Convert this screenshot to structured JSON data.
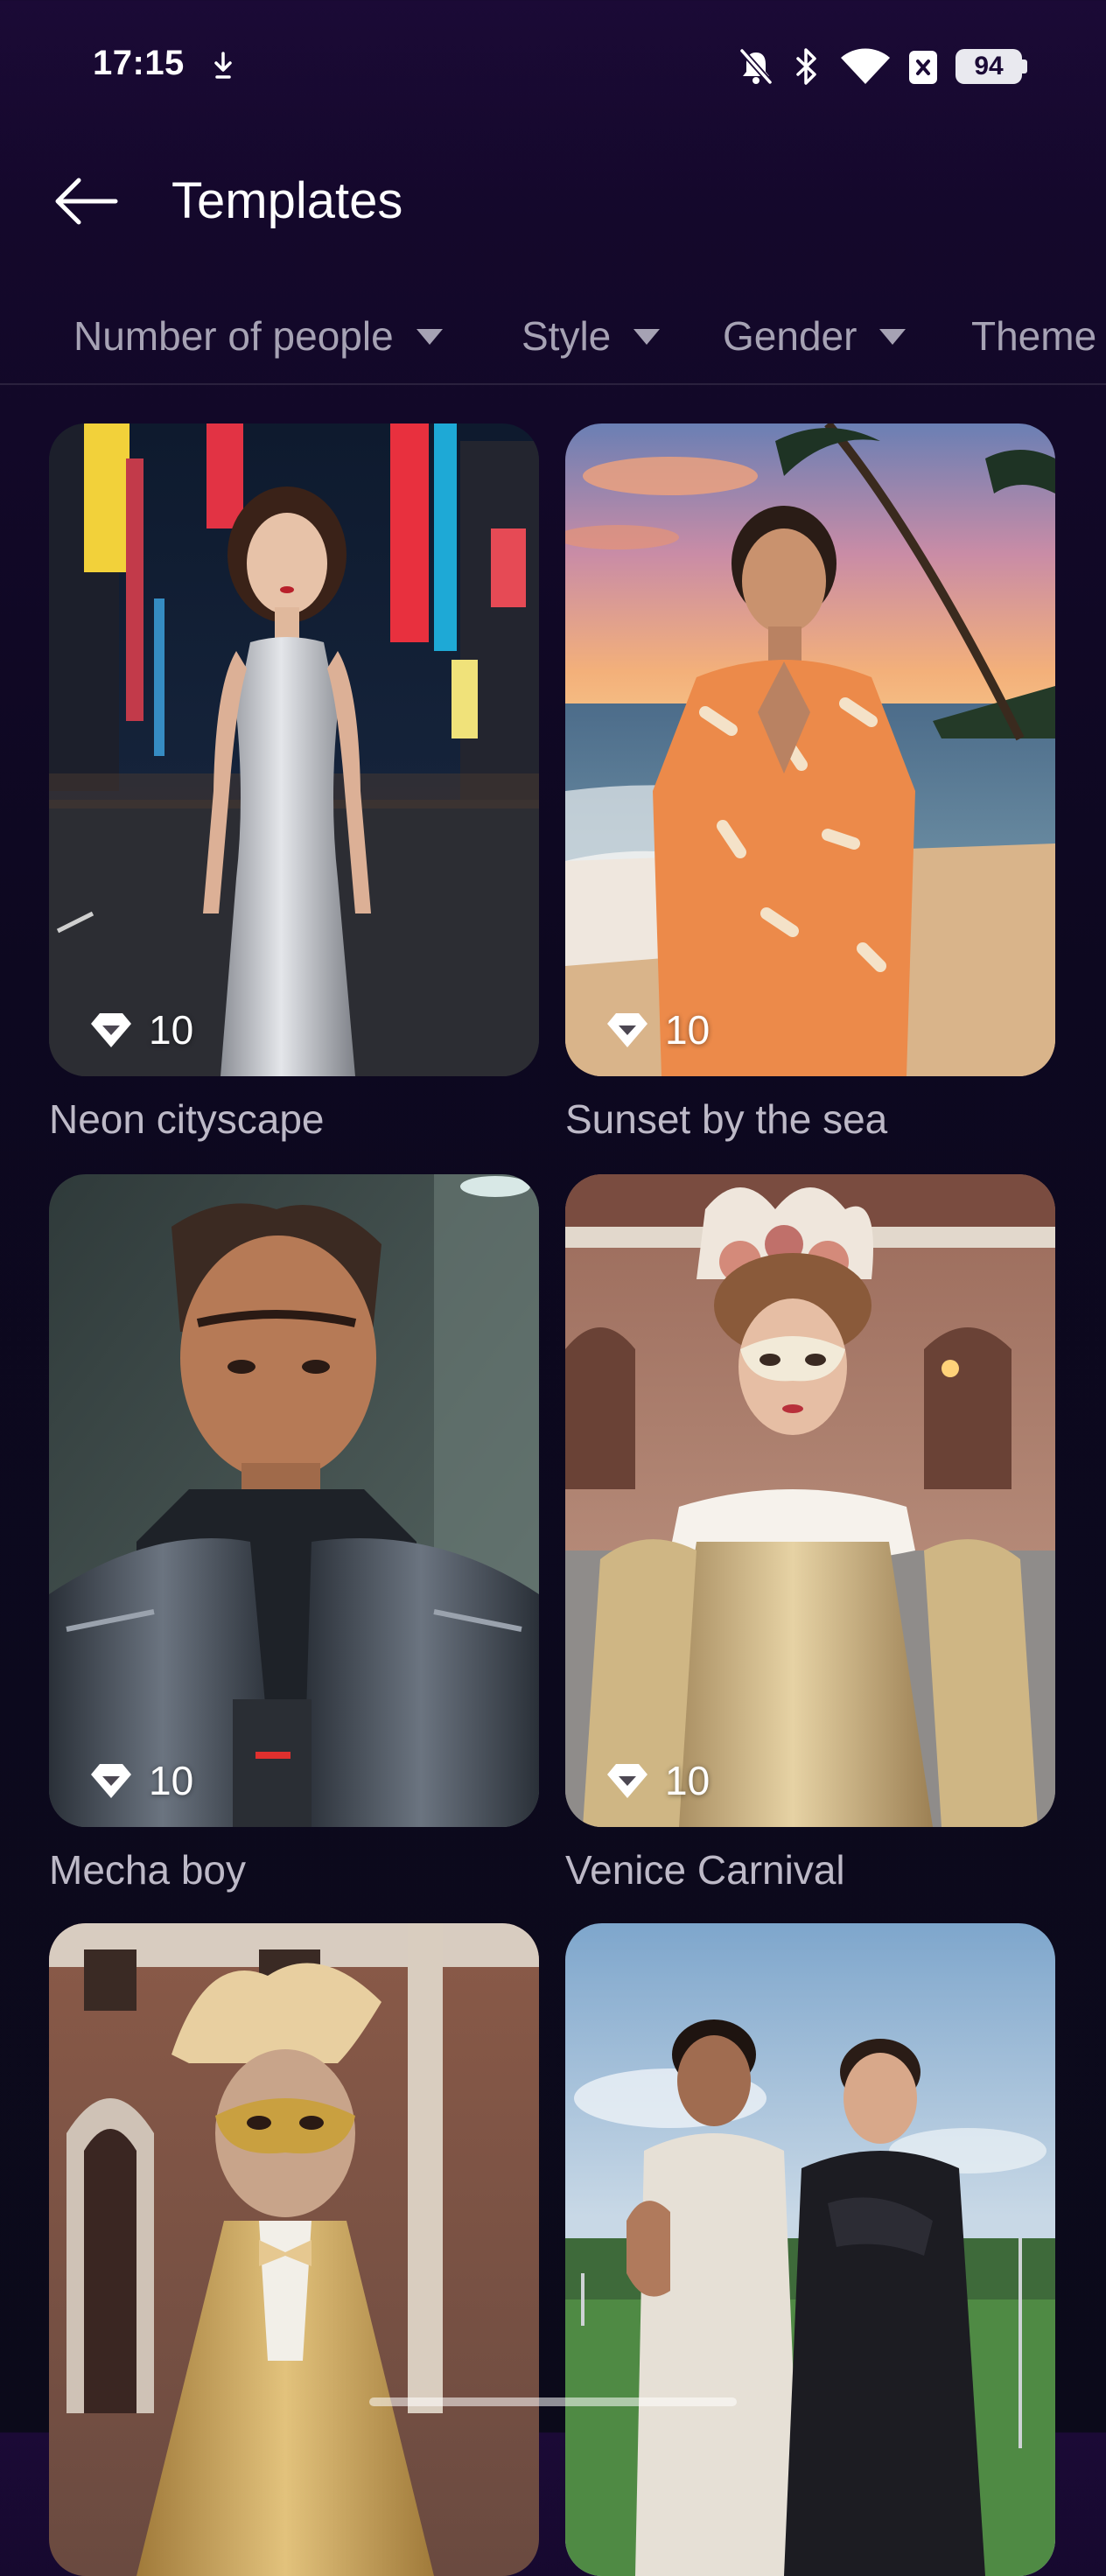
{
  "status_bar": {
    "time": "17:15",
    "battery": "94",
    "icons": [
      "download-indicator-icon",
      "mute-icon",
      "bluetooth-icon",
      "wifi-icon",
      "sim-off-icon",
      "battery-icon"
    ]
  },
  "header": {
    "title": "Templates",
    "back_icon": "back-arrow-icon"
  },
  "filters": [
    {
      "label": "Number of people"
    },
    {
      "label": "Style"
    },
    {
      "label": "Gender"
    },
    {
      "label": "Theme"
    }
  ],
  "templates": [
    {
      "title": "Neon cityscape",
      "credits": "10",
      "credit_icon": "diamond-icon"
    },
    {
      "title": "Sunset by the sea",
      "credits": "10",
      "credit_icon": "diamond-icon"
    },
    {
      "title": "Mecha boy",
      "credits": "10",
      "credit_icon": "diamond-icon"
    },
    {
      "title": "Venice Carnival",
      "credits": "10",
      "credit_icon": "diamond-icon"
    },
    {
      "title": "",
      "credits": "",
      "credit_icon": ""
    },
    {
      "title": "",
      "credits": "",
      "credit_icon": ""
    }
  ],
  "colors": {
    "background_top": "#1b0a36",
    "background_bottom": "#0b0a1a",
    "text_primary": "#ffffff",
    "text_secondary": "#a6a2b4"
  }
}
